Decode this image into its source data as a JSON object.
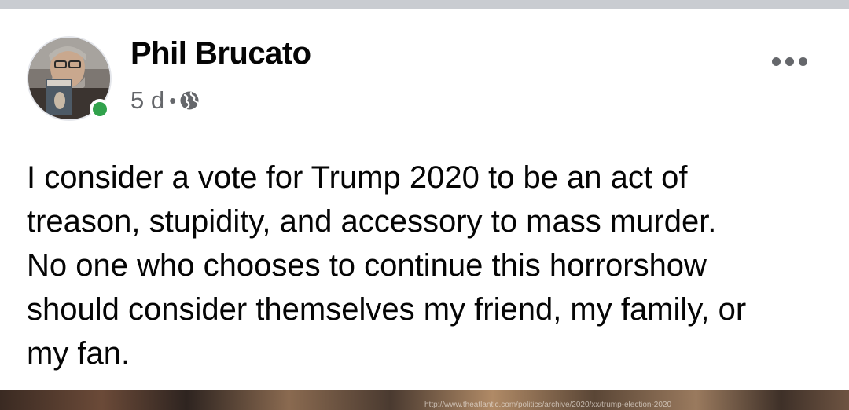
{
  "post": {
    "author": "Phil Brucato",
    "timestamp": "5 d",
    "separator": "•",
    "audience_icon": "globe-icon",
    "online_status": "online",
    "body_lines": [
      "I consider a vote for Trump 2020 to be an act of",
      "treason, stupidity, and accessory to mass murder.",
      "No one who chooses to continue this horrorshow",
      "should consider themselves my friend, my family, or",
      "my fan."
    ],
    "more_options_icon": "more-options-icon",
    "image_caption": "http://www.theatlantic.com/politics/archive/2020/xx/trump-election-2020"
  },
  "colors": {
    "name": "#050505",
    "meta": "#65676b",
    "online": "#31a24c",
    "divider": "#c9ccd1"
  }
}
